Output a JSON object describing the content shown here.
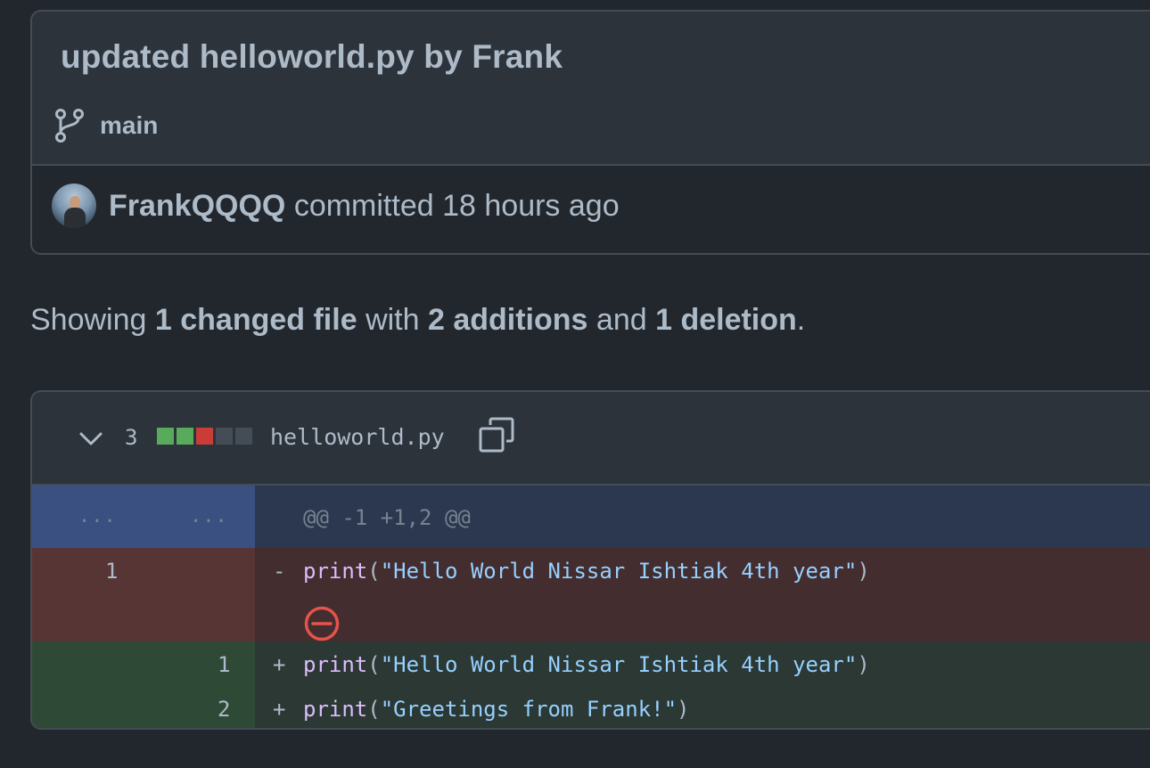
{
  "commit": {
    "title": "updated helloworld.py by Frank",
    "branch": "main",
    "author": "FrankQQQQ",
    "action": "committed",
    "time": "18 hours ago"
  },
  "summary": {
    "prefix": "Showing",
    "files": "1 changed file",
    "with": "with",
    "additions": "2 additions",
    "and": "and",
    "deletions": "1 deletion",
    "suffix": "."
  },
  "file": {
    "change_count": "3",
    "diffstat": [
      "add",
      "add",
      "del",
      "neutral",
      "neutral"
    ],
    "name": "helloworld.py",
    "hunk": {
      "old_dots": "...",
      "new_dots": "...",
      "header": "@@ -1 +1,2 @@"
    },
    "lines": [
      {
        "type": "del",
        "old": "1",
        "new": "",
        "marker": "-",
        "fn": "print",
        "open": "(",
        "str": "\"Hello World Nissar Ishtiak 4th year\"",
        "close": ")"
      },
      {
        "type": "add",
        "old": "",
        "new": "1",
        "marker": "+",
        "fn": "print",
        "open": "(",
        "str": "\"Hello World Nissar Ishtiak 4th year\"",
        "close": ")"
      },
      {
        "type": "add",
        "old": "",
        "new": "2",
        "marker": "+",
        "fn": "print",
        "open": "(",
        "str": "\"Greetings from Frank!\"",
        "close": ")"
      }
    ]
  },
  "colors": {
    "diffstat_add": "#57ab5a",
    "diffstat_del": "#c93c37",
    "diffstat_neutral": "#444c56",
    "delete_icon": "#e5534b"
  },
  "icons": {
    "branch": "git-branch-icon",
    "chevron": "chevron-down-icon",
    "copy": "copy-icon",
    "remove": "no-entry-icon"
  }
}
